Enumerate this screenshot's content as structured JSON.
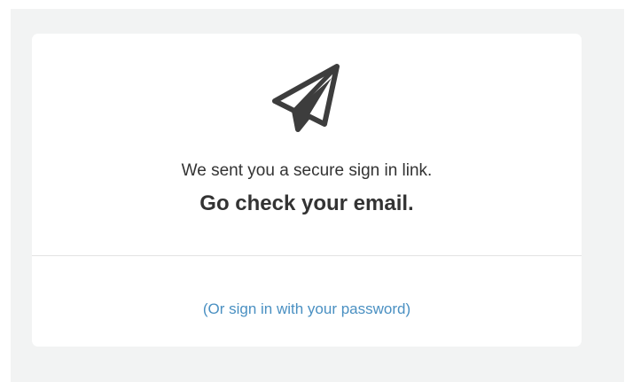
{
  "card": {
    "icon": "paper-plane-icon",
    "message": "We sent you a secure sign in link.",
    "headline": "Go check your email.",
    "alt_link_label": "(Or sign in with your password)"
  },
  "colors": {
    "text": "#333333",
    "link": "#4a90c2",
    "icon": "#3d3d3d",
    "backdrop": "#f2f3f3"
  }
}
